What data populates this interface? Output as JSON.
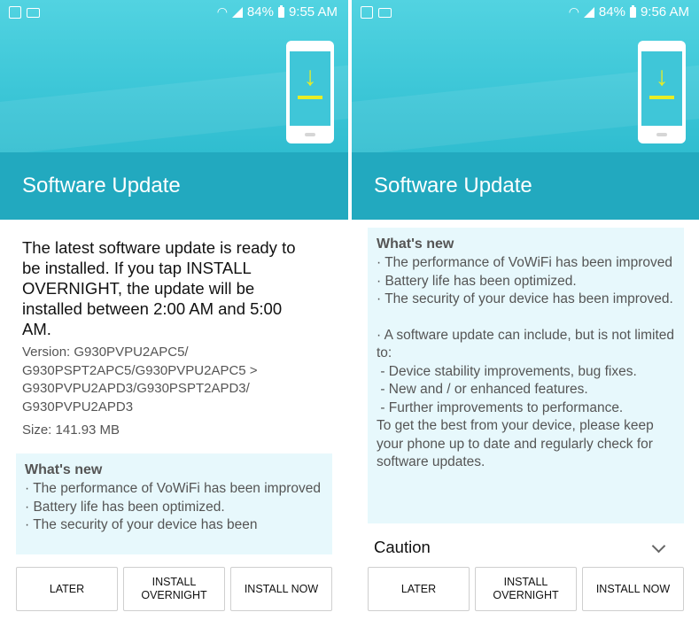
{
  "colors": {
    "banner_top": "#52d3e1",
    "banner_bottom": "#22a9bf",
    "whats_new_bg": "#e7f8fc",
    "illustration_accent": "#e8ed24"
  },
  "screens": [
    {
      "status_bar": {
        "battery": "84%",
        "time": "9:55 AM",
        "icons": [
          "screenshot-icon",
          "mail-icon",
          "wifi-icon",
          "signal-icon",
          "battery-icon"
        ]
      },
      "title": "Software Update",
      "lead_text": "The latest software update is ready to be installed. If you tap INSTALL OVERNIGHT, the update will be installed between 2:00 AM and 5:00 AM.",
      "version_text": "Version: G930PVPU2APC5/ G930PSPT2APC5/G930PVPU2APC5 > G930PVPU2APD3/G930PSPT2APD3/ G930PVPU2APD3",
      "size_text": "Size: 141.93 MB",
      "whats_new": {
        "title": "What's new",
        "lines": [
          "· The performance of VoWiFi has been improved",
          "· Battery life has been optimized.",
          "· The security of your device has been"
        ]
      },
      "buttons": {
        "later": "LATER",
        "overnight": "INSTALL OVERNIGHT",
        "now": "INSTALL NOW"
      }
    },
    {
      "status_bar": {
        "battery": "84%",
        "time": "9:56 AM",
        "icons": [
          "screenshot-icon",
          "mail-icon",
          "wifi-icon",
          "signal-icon",
          "battery-icon"
        ]
      },
      "title": "Software Update",
      "whats_new": {
        "title": "What's new",
        "lines": [
          "· The performance of VoWiFi has been improved",
          "· Battery life has been optimized.",
          "· The security of your device has been improved."
        ],
        "extra_lines": [
          "· A software update can include, but is not limited to:",
          " - Device stability improvements, bug fixes.",
          " - New and / or enhanced features.",
          " - Further improvements to performance.",
          "To get the best from your device, please keep your phone up to date and regularly check for software updates."
        ]
      },
      "caution": "Caution",
      "buttons": {
        "later": "LATER",
        "overnight": "INSTALL OVERNIGHT",
        "now": "INSTALL NOW"
      }
    }
  ]
}
